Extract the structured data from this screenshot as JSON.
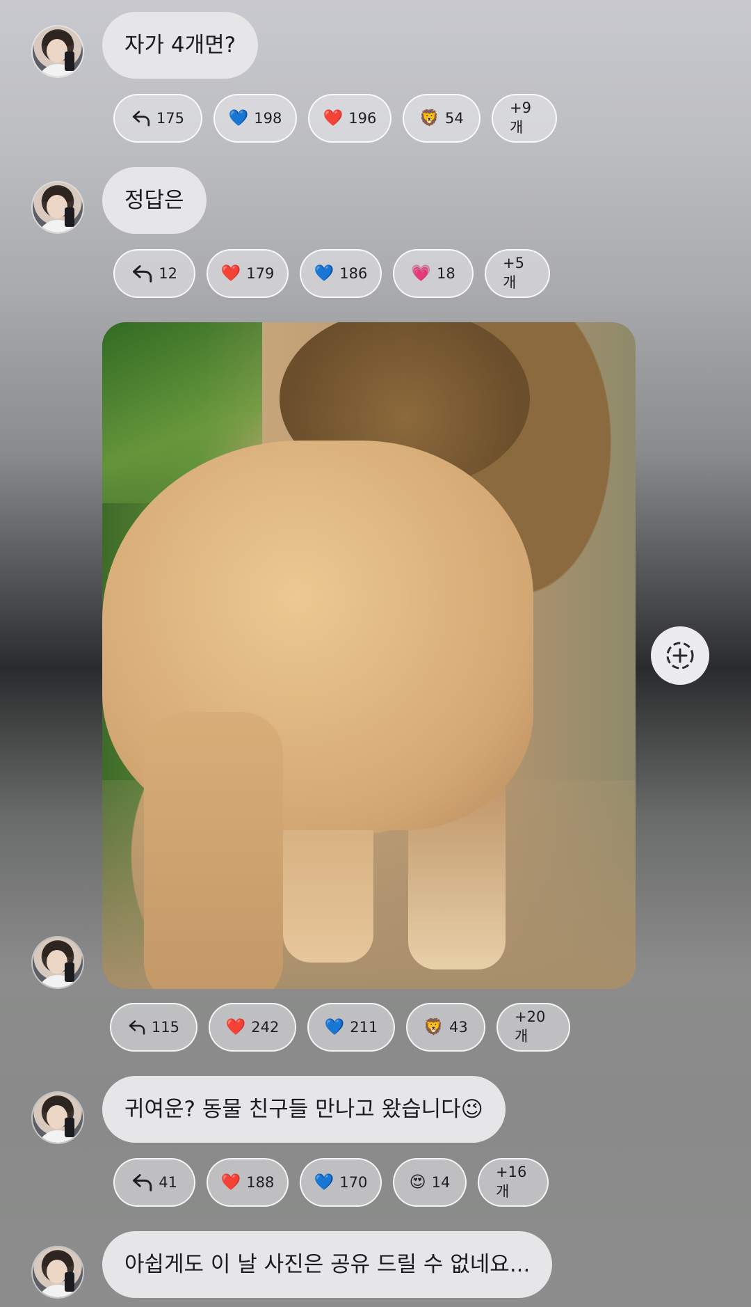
{
  "messages": [
    {
      "text": "자가 4개면?",
      "reactions": [
        {
          "icon": "reply-icon",
          "count": "175"
        },
        {
          "icon": "blue-heart-icon",
          "emoji": "💙",
          "count": "198"
        },
        {
          "icon": "red-heart-icon",
          "emoji": "❤️",
          "count": "196"
        },
        {
          "icon": "lion-icon",
          "emoji": "🦁",
          "count": "54"
        },
        {
          "more": "+9개"
        }
      ]
    },
    {
      "text": "정답은",
      "reactions": [
        {
          "icon": "reply-icon",
          "count": "12"
        },
        {
          "icon": "red-heart-icon",
          "emoji": "❤️",
          "count": "179"
        },
        {
          "icon": "blue-heart-icon",
          "emoji": "💙",
          "count": "186"
        },
        {
          "icon": "pink-heart-icon",
          "emoji": "💗",
          "count": "18"
        },
        {
          "more": "+5개"
        }
      ]
    },
    {
      "image": "lion-photo",
      "reactions": [
        {
          "icon": "reply-icon",
          "count": "115"
        },
        {
          "icon": "red-heart-icon",
          "emoji": "❤️",
          "count": "242"
        },
        {
          "icon": "blue-heart-icon",
          "emoji": "💙",
          "count": "211"
        },
        {
          "icon": "lion-icon",
          "emoji": "🦁",
          "count": "43"
        },
        {
          "more": "+20개"
        }
      ]
    },
    {
      "text": "귀여운? 동물 친구들 만나고 왔습니다😉",
      "reactions": [
        {
          "icon": "reply-icon",
          "count": "41"
        },
        {
          "icon": "red-heart-icon",
          "emoji": "❤️",
          "count": "188"
        },
        {
          "icon": "blue-heart-icon",
          "emoji": "💙",
          "count": "170"
        },
        {
          "icon": "heart-eyes-icon",
          "emoji": "😍",
          "count": "14"
        },
        {
          "more": "+16개"
        }
      ]
    },
    {
      "text": "아쉽게도 이 날 사진은 공유 드릴 수 없네요..."
    }
  ],
  "add_button_icon": "add-reaction-icon"
}
